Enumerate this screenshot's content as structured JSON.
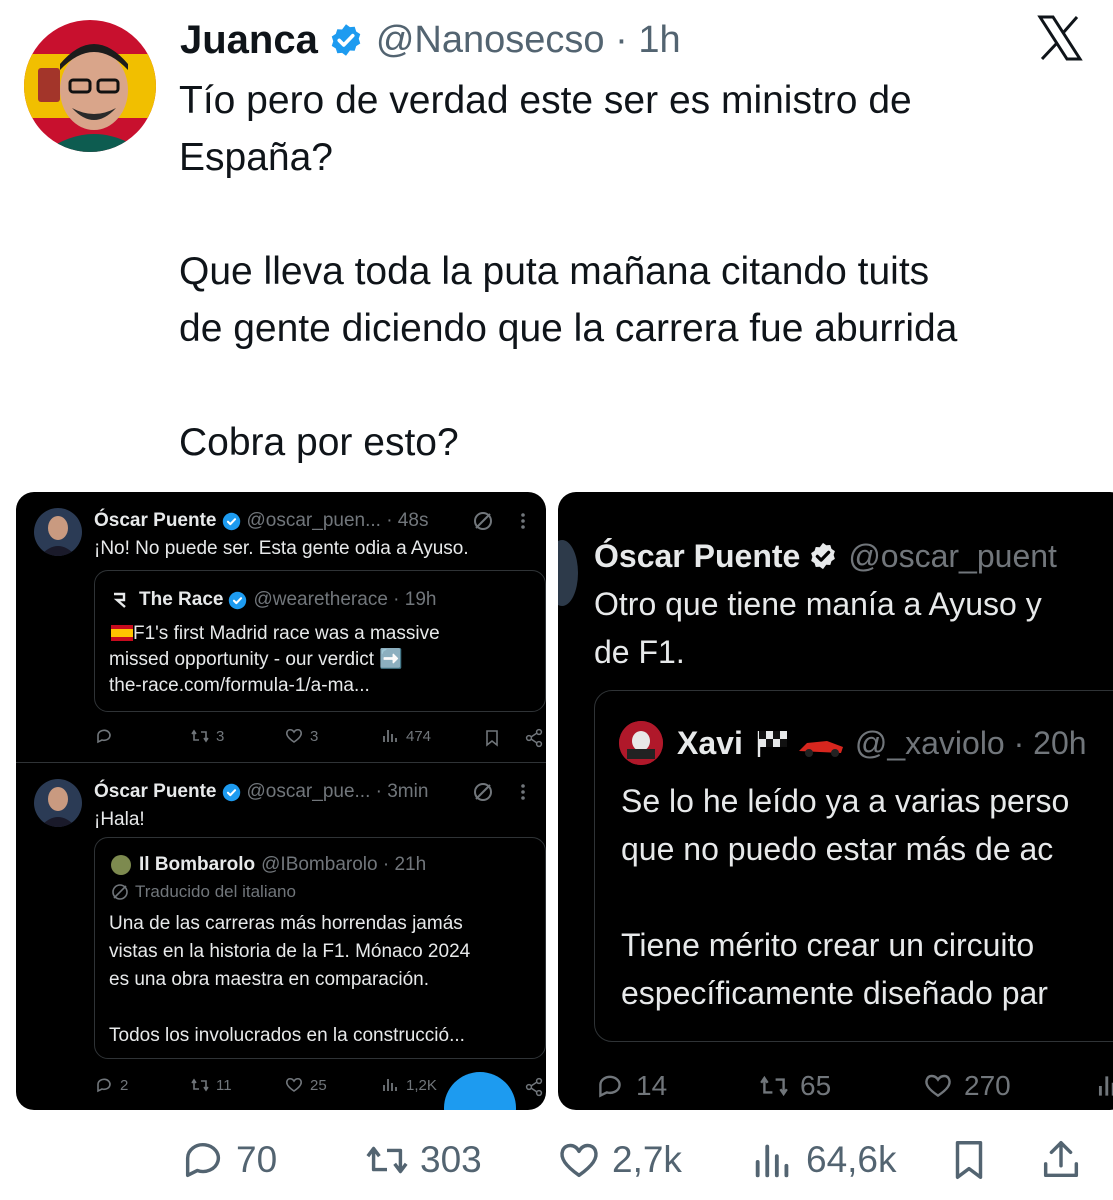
{
  "tweet": {
    "author_name": "Juanca",
    "handle_time": "@Nanosecso · 1h",
    "text": "Tío pero de verdad este ser es ministro de\nEspaña?\n\nQue lleva toda la puta mañana citando tuits\nde gente diciendo que la carrera fue aburrida\n\nCobra por esto?",
    "icons": [
      "verified-icon",
      "x-logo-icon"
    ],
    "colors": {
      "verified": "#1d9bf0",
      "text": "#0f1419",
      "secondary": "#536471"
    }
  },
  "left_shot": {
    "post1": {
      "name": "Óscar Puente",
      "handle_time": "@oscar_puen... · 48s",
      "text": "¡No! No puede ser. Esta gente odia a Ayuso.",
      "quote": {
        "name": "The Race",
        "handle_time": "@wearetherace · 19h",
        "text": "F1's first Madrid race was a massive\nmissed opportunity - our verdict ➡️\nthe-race.com/formula-1/a-ma..."
      },
      "actions": {
        "replies": "",
        "retweets": "3",
        "likes": "3",
        "views": "474"
      }
    },
    "post2": {
      "name": "Óscar Puente",
      "handle_time": "@oscar_pue... · 3min",
      "text": "¡Hala!",
      "quote": {
        "name": "Il Bombarolo",
        "handle_time": "@IBombarolo · 21h",
        "translated": "Traducido del italiano",
        "text": "Una de las carreras más horrendas jamás\nvistas en la historia de la F1. Mónaco 2024\nes una obra maestra en comparación.\n\nTodos los involucrados en la construcció..."
      },
      "actions": {
        "replies": "2",
        "retweets": "11",
        "likes": "25",
        "views": "1,2K"
      }
    }
  },
  "right_shot": {
    "name": "Óscar Puente",
    "handle": "@oscar_puent",
    "text": "Otro que tiene manía a Ayuso y\nde F1.",
    "quote": {
      "name": "Xavi",
      "handle_time": "@_xaviolo · 20h",
      "text": "Se lo he leído ya a varias perso\nque no puedo estar más de ac\n\nTiene mérito crear un circuito\nespecíficamente diseñado par"
    },
    "actions": {
      "replies": "14",
      "retweets": "65",
      "likes": "270"
    }
  },
  "bottom_actions": {
    "replies": "70",
    "retweets": "303",
    "likes": "2,7k",
    "views": "64,6k"
  }
}
